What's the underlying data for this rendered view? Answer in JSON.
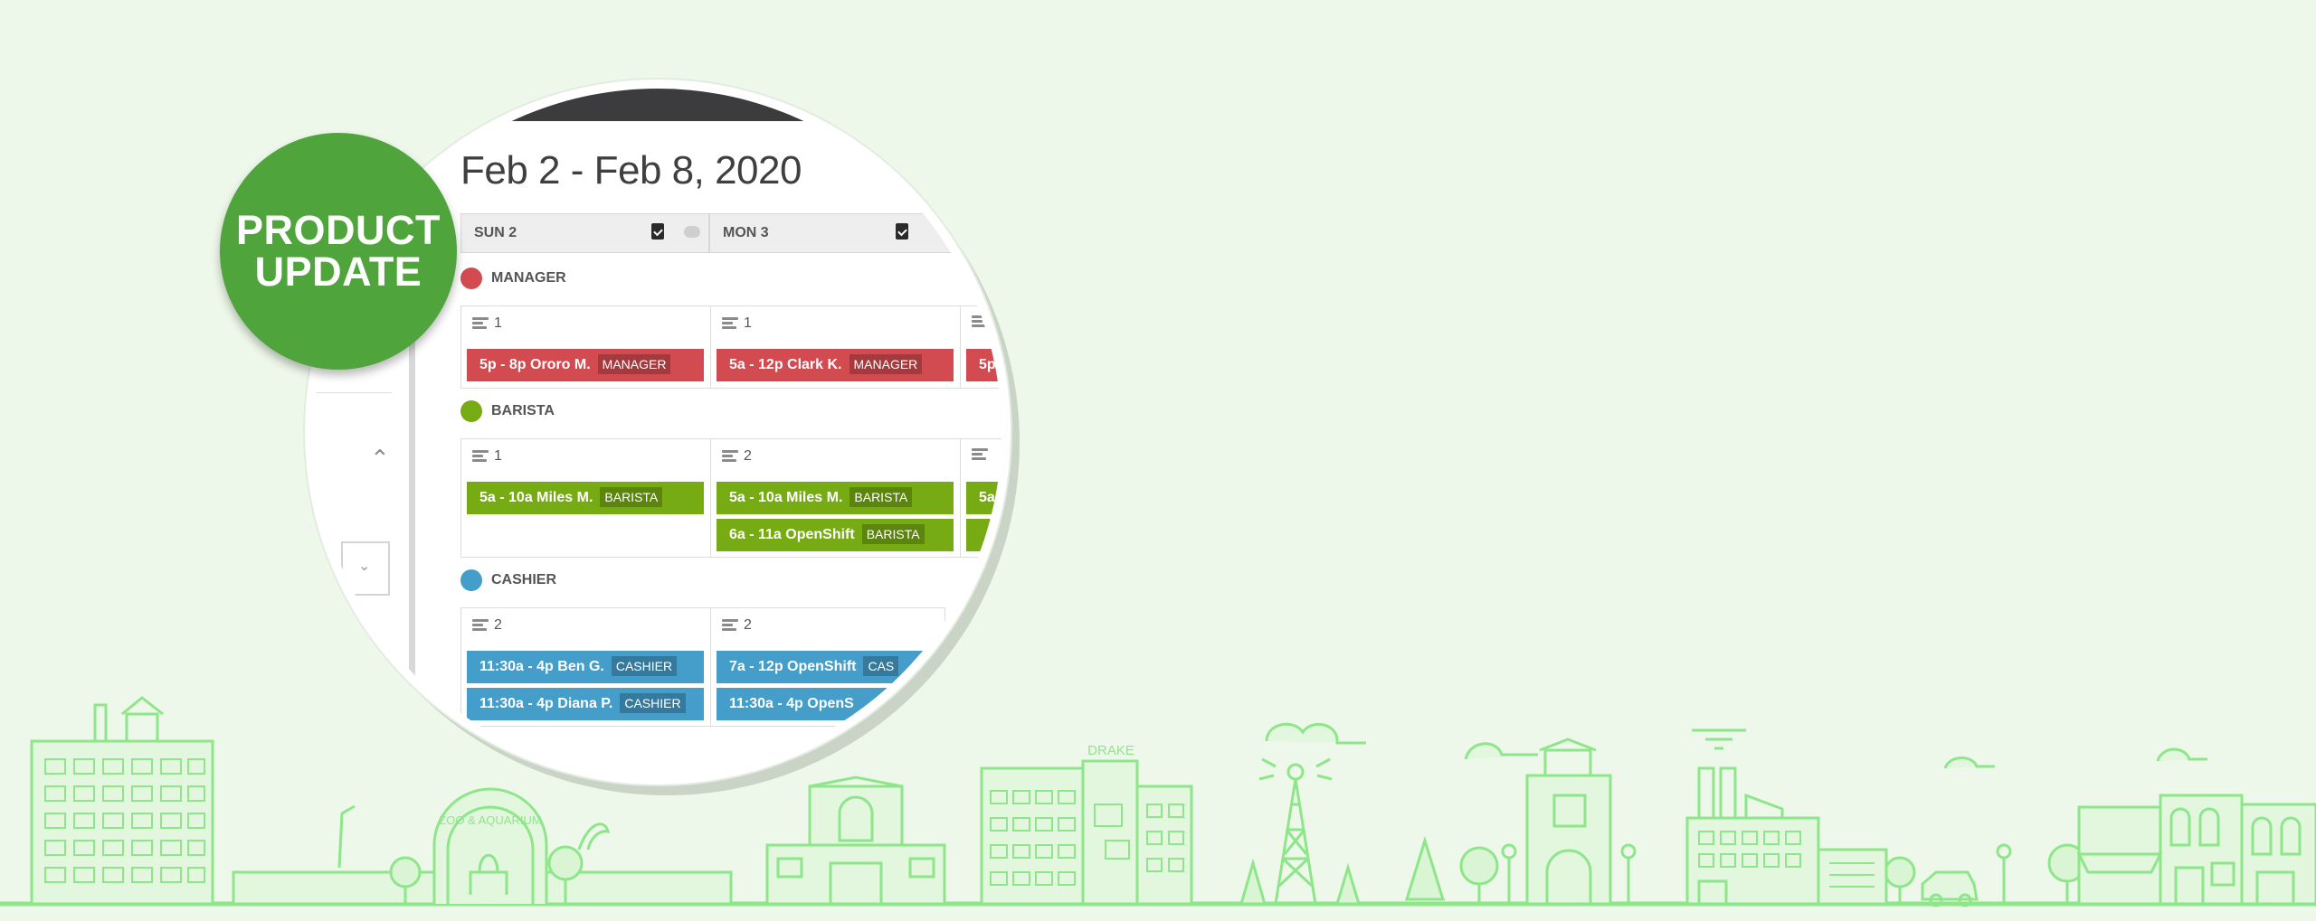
{
  "badge": {
    "line1": "PRODUCT",
    "line2": "UPDATE"
  },
  "schedule": {
    "date_range": "Feb 2 - Feb 8, 2020",
    "days": [
      {
        "label": "SUN 2"
      },
      {
        "label": "MON 3"
      }
    ],
    "groups": [
      {
        "name": "MANAGER",
        "color": "#d24b50",
        "cells": [
          {
            "count": "1",
            "shifts": [
              {
                "text": "5p - 8p Ororo M.",
                "tag": "MANAGER"
              }
            ]
          },
          {
            "count": "1",
            "shifts": [
              {
                "text": "5a - 12p Clark K.",
                "tag": "MANAGER"
              }
            ]
          },
          {
            "count": "",
            "shifts": [
              {
                "text": "5p",
                "tag": ""
              }
            ]
          }
        ]
      },
      {
        "name": "BARISTA",
        "color": "#77ab14",
        "cells": [
          {
            "count": "1",
            "shifts": [
              {
                "text": "5a - 10a Miles M.",
                "tag": "BARISTA"
              }
            ]
          },
          {
            "count": "2",
            "shifts": [
              {
                "text": "5a - 10a Miles M.",
                "tag": "BARISTA"
              },
              {
                "text": "6a - 11a OpenShift",
                "tag": "BARISTA"
              }
            ]
          },
          {
            "count": "",
            "shifts": [
              {
                "text": "5a",
                "tag": ""
              },
              {
                "text": "",
                "tag": ""
              }
            ]
          }
        ]
      },
      {
        "name": "CASHIER",
        "color": "#459dca",
        "cells": [
          {
            "count": "2",
            "shifts": [
              {
                "text": "11:30a - 4p Ben G.",
                "tag": "CASHIER"
              },
              {
                "text": "11:30a - 4p Diana P.",
                "tag": "CASHIER"
              }
            ]
          },
          {
            "count": "2",
            "shifts": [
              {
                "text": "7a - 12p OpenShift",
                "tag": "CAS"
              },
              {
                "text": "11:30a - 4p OpenS",
                "tag": ""
              }
            ]
          }
        ]
      }
    ]
  },
  "skyline": {
    "zoo_sign": "ZOO & AQUARIUM",
    "store_sign": "DRAKE",
    "line_color": "#8ee68a",
    "fill_color": "#d9f5d3"
  }
}
